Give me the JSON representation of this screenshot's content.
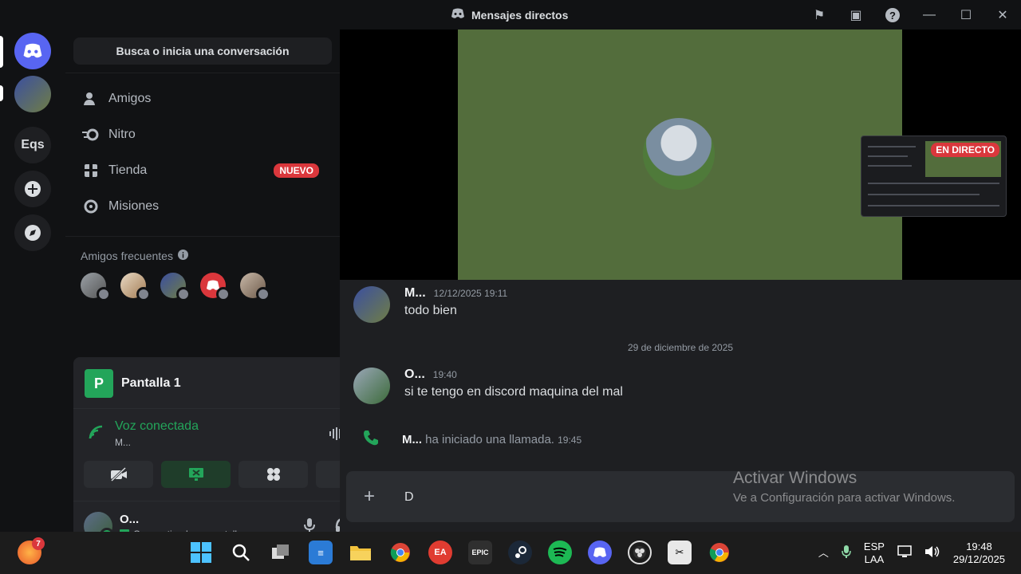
{
  "window": {
    "title": "Mensajes directos",
    "icons": [
      "inbox-icon",
      "screen-share-icon",
      "help-icon",
      "minimize-icon",
      "maximize-icon",
      "close-icon"
    ]
  },
  "rail": {
    "server_abbrev": "Eqs"
  },
  "dm": {
    "search_label": "Busca o inicia una conversación",
    "nav": [
      {
        "label": "Amigos",
        "icon": "friends-icon"
      },
      {
        "label": "Nitro",
        "icon": "nitro-icon"
      },
      {
        "label": "Tienda",
        "icon": "shop-icon",
        "badge": "NUEVO"
      },
      {
        "label": "Misiones",
        "icon": "quests-icon"
      }
    ],
    "frequent_label": "Amigos frecuentes"
  },
  "panel": {
    "screen_badge": "P",
    "screen_title": "Pantalla 1",
    "voice_status": "Voz conectada",
    "voice_channel": "M...",
    "user_name": "O...",
    "user_status": "Compartiendo su pantalla"
  },
  "stage": {
    "live_badge": "EN DIRECTO"
  },
  "messages": [
    {
      "author": "M...",
      "time": "12/12/2025 19:11",
      "text": "todo bien"
    },
    {
      "author": "O...",
      "time": "19:40",
      "text": "si te tengo en discord maquina del mal"
    }
  ],
  "date_divider": "29 de diciembre de 2025",
  "call_event": {
    "author": "M...",
    "text": "ha iniciado una llamada.",
    "time": "19:45"
  },
  "composer": {
    "value": "D"
  },
  "watermark": {
    "line1": "Activar Windows",
    "line2": "Ve a Configuración para activar Windows."
  },
  "taskbar": {
    "notif_count": "7",
    "lang": "ESP",
    "layout": "LAA",
    "time": "19:48",
    "date": "29/12/2025"
  },
  "colors": {
    "accent": "#5865f2",
    "green": "#23a55a",
    "red": "#da373c"
  }
}
